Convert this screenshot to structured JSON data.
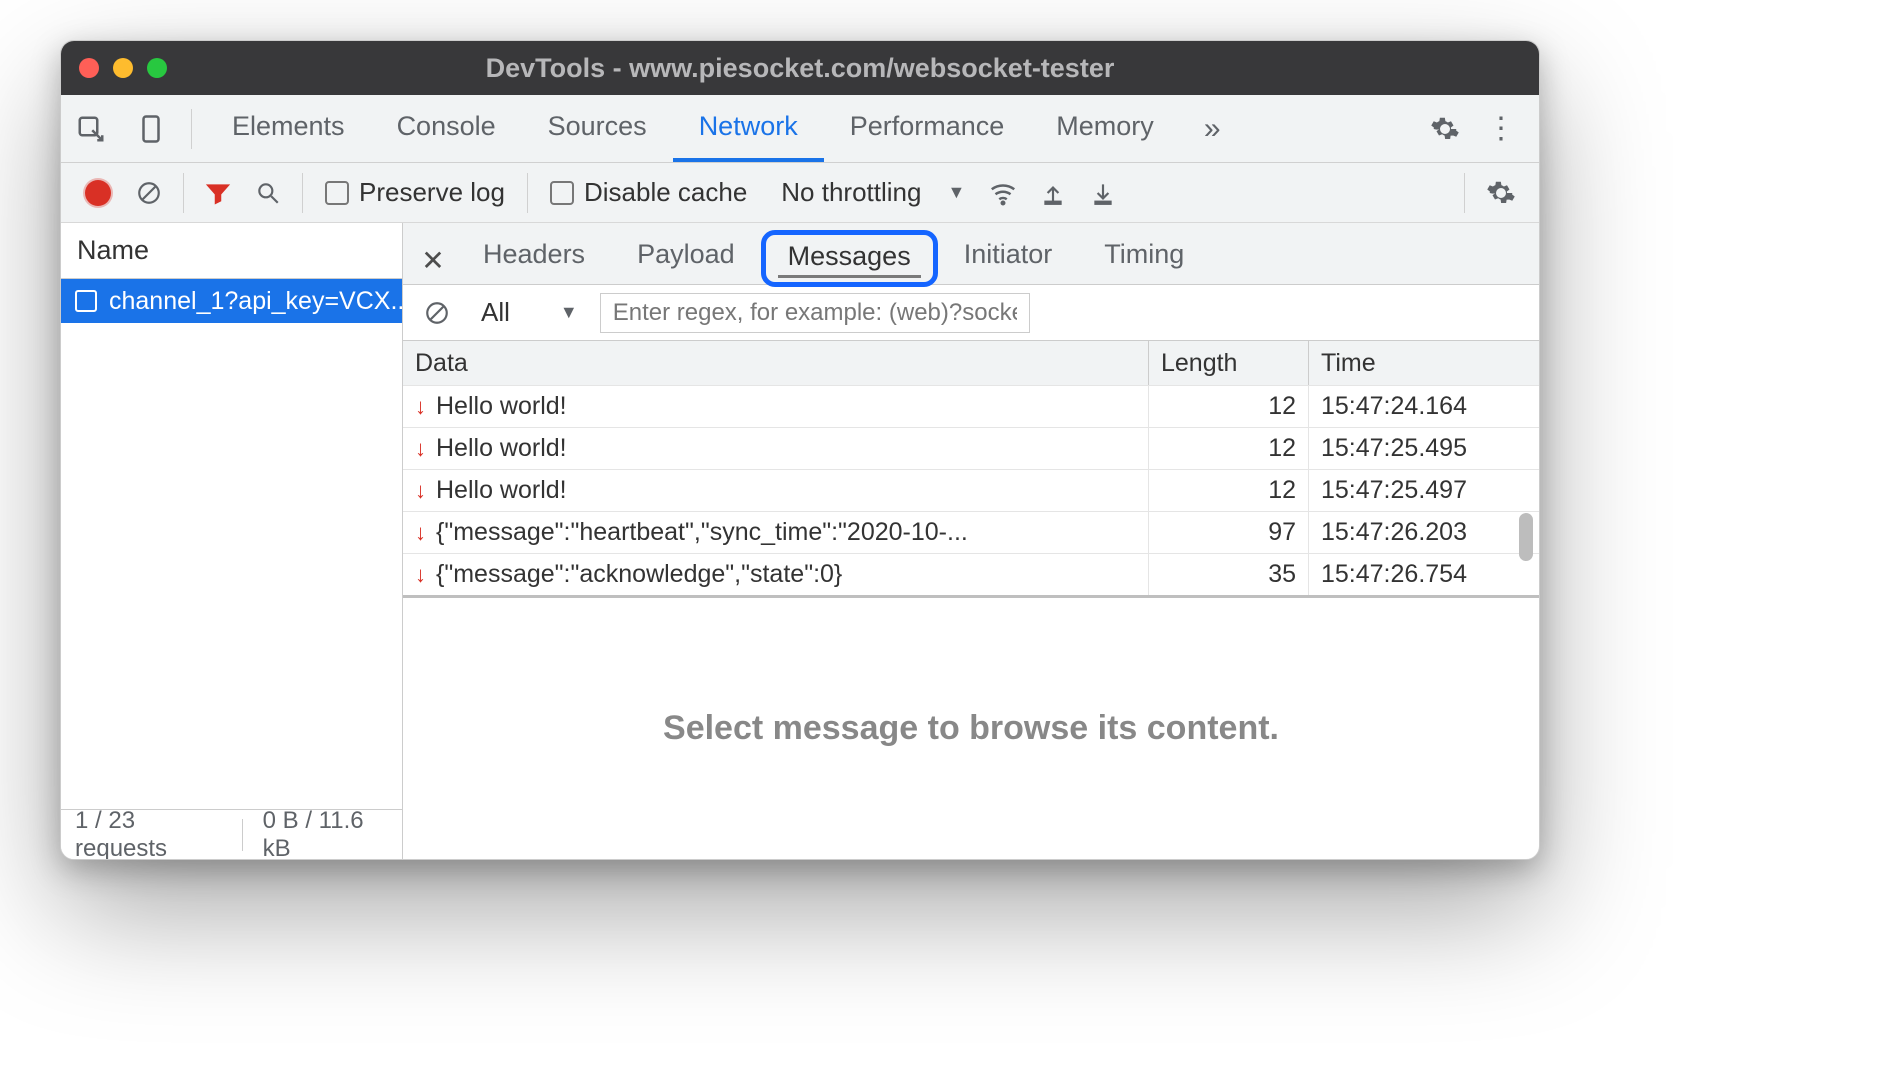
{
  "window": {
    "title": "DevTools - www.piesocket.com/websocket-tester"
  },
  "mainTabs": {
    "items": [
      "Elements",
      "Console",
      "Sources",
      "Network",
      "Performance",
      "Memory"
    ],
    "active": "Network"
  },
  "netToolbar": {
    "preserveLog": "Preserve log",
    "disableCache": "Disable cache",
    "throttling": "No throttling"
  },
  "requests": {
    "nameHeader": "Name",
    "items": [
      {
        "label": "channel_1?api_key=VCX..."
      }
    ],
    "footerCount": "1 / 23 requests",
    "footerSize": "0 B / 11.6 kB"
  },
  "detailTabs": {
    "items": [
      "Headers",
      "Payload",
      "Messages",
      "Initiator",
      "Timing"
    ],
    "active": "Messages"
  },
  "filter": {
    "all": "All",
    "regexPlaceholder": "Enter regex, for example: (web)?socket"
  },
  "messages": {
    "headers": {
      "data": "Data",
      "length": "Length",
      "time": "Time"
    },
    "rows": [
      {
        "dir": "down",
        "data": "Hello world!",
        "length": 12,
        "time": "15:47:24.164"
      },
      {
        "dir": "down",
        "data": "Hello world!",
        "length": 12,
        "time": "15:47:25.495"
      },
      {
        "dir": "down",
        "data": "Hello world!",
        "length": 12,
        "time": "15:47:25.497"
      },
      {
        "dir": "down",
        "data": "{\"message\":\"heartbeat\",\"sync_time\":\"2020-10-...",
        "length": 97,
        "time": "15:47:26.203"
      },
      {
        "dir": "down",
        "data": "{\"message\":\"acknowledge\",\"state\":0}",
        "length": 35,
        "time": "15:47:26.754"
      }
    ],
    "placeholder": "Select message to browse its content."
  }
}
